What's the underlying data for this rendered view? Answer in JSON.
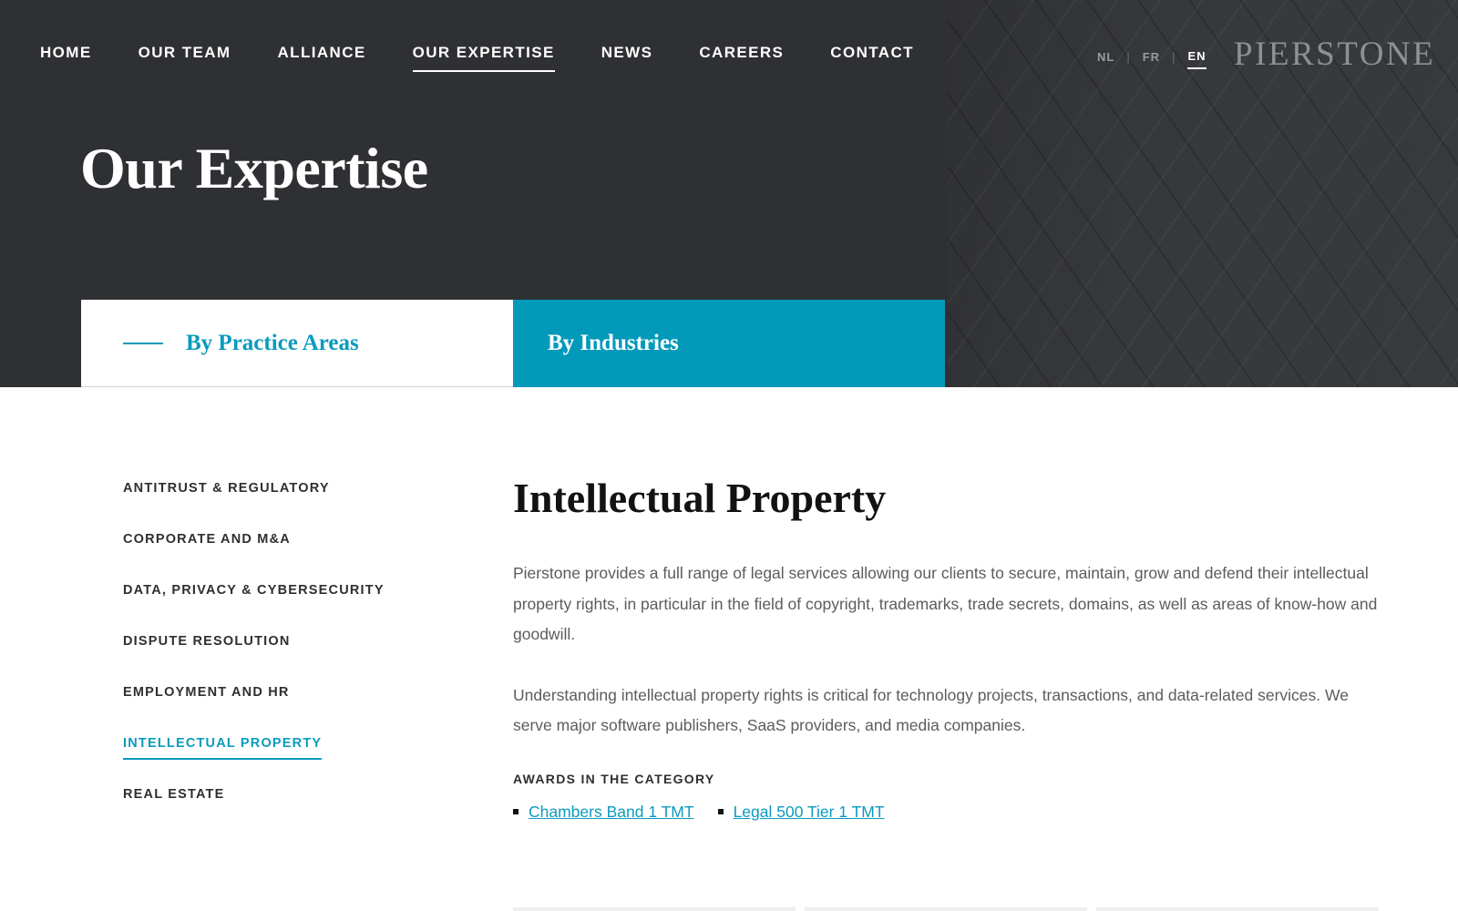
{
  "nav": {
    "items": [
      {
        "label": "HOME",
        "active": false
      },
      {
        "label": "OUR TEAM",
        "active": false
      },
      {
        "label": "ALLIANCE",
        "active": false
      },
      {
        "label": "OUR EXPERTISE",
        "active": true
      },
      {
        "label": "NEWS",
        "active": false
      },
      {
        "label": "CAREERS",
        "active": false
      },
      {
        "label": "CONTACT",
        "active": false
      }
    ]
  },
  "languages": {
    "items": [
      {
        "label": "NL",
        "active": false
      },
      {
        "label": "FR",
        "active": false
      },
      {
        "label": "EN",
        "active": true
      }
    ],
    "separator": "|"
  },
  "logo": "PIERSTONE",
  "hero": {
    "title": "Our Expertise"
  },
  "tabs": {
    "practice_areas": "By Practice Areas",
    "industries": "By Industries"
  },
  "sidebar": {
    "items": [
      {
        "label": "ANTITRUST & REGULATORY",
        "active": false
      },
      {
        "label": "CORPORATE AND M&A",
        "active": false
      },
      {
        "label": "DATA, PRIVACY & CYBERSECURITY",
        "active": false
      },
      {
        "label": "DISPUTE RESOLUTION",
        "active": false
      },
      {
        "label": "EMPLOYMENT AND HR",
        "active": false
      },
      {
        "label": "INTELLECTUAL PROPERTY",
        "active": true
      },
      {
        "label": "REAL ESTATE",
        "active": false
      }
    ]
  },
  "content": {
    "title": "Intellectual Property",
    "paragraphs": [
      "Pierstone provides a full range of legal services allowing our clients to secure, maintain, grow and defend their intellectual property rights, in particular in the field of copyright, trademarks, trade secrets, domains, as well as areas of know-how and goodwill.",
      "Understanding intellectual property rights is critical for technology projects, transactions, and data-related services. We serve major software publishers, SaaS providers, and media companies."
    ],
    "awards_heading": "AWARDS IN THE CATEGORY",
    "awards": [
      "Chambers Band 1 TMT",
      "Legal 500 Tier 1 TMT"
    ]
  },
  "colors": {
    "hero_background": "#2f3033",
    "accent": "#0a9bbd",
    "industries_tab": "#039aba"
  }
}
